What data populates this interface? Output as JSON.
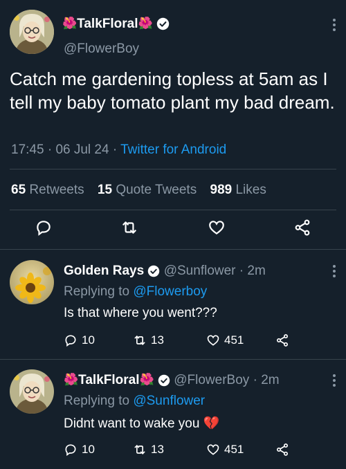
{
  "main_tweet": {
    "display_name": "TalkFloral",
    "name_emoji_left": "🌺",
    "name_emoji_right": "🌺",
    "handle": "@FlowerBoy",
    "text": "Catch me gardening topless at 5am as I tell my baby tomato plant my bad dream.",
    "time": "17:45",
    "date": "06 Jul 24",
    "source": "Twitter for Android",
    "retweets_count": "65",
    "retweets_label": "Retweets",
    "quotes_count": "15",
    "quotes_label": "Quote Tweets",
    "likes_count": "989",
    "likes_label": "Likes"
  },
  "replies": [
    {
      "display_name": "Golden Rays",
      "handle": "@Sunflower",
      "time": "2m",
      "replying_label": "Replying to",
      "replying_to": "@Flowerboy",
      "text": "Is that where you went???",
      "replies": "10",
      "retweets": "13",
      "likes": "451"
    },
    {
      "display_name": "TalkFloral",
      "name_emoji_left": "🌺",
      "name_emoji_right": "🌺",
      "handle": "@FlowerBoy",
      "time": "2m",
      "replying_label": "Replying to",
      "replying_to": "@Sunflower",
      "text": "Didnt want to wake you",
      "text_emoji": "💔",
      "replies": "10",
      "retweets": "13",
      "likes": "451"
    }
  ],
  "icons": {
    "reply": "reply-icon",
    "retweet": "retweet-icon",
    "like": "heart-icon",
    "share": "share-icon",
    "more": "more-vertical-icon",
    "verified": "verified-badge-icon"
  },
  "colors": {
    "background": "#15202b",
    "accent": "#1d9bf0",
    "muted": "#8b98a5",
    "divider": "#38444d"
  }
}
